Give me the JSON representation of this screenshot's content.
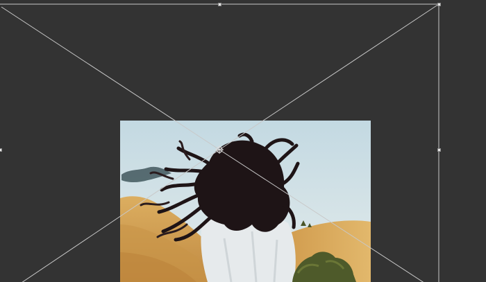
{
  "app": {
    "mode": "free-transform",
    "canvas_color": "#333333",
    "guide_color": "#c8c8c8",
    "handle_color": "#e6e6e6"
  },
  "layer": {
    "content": "photo-woman-hair-flying-desert",
    "palette": {
      "sky_top": "#c6dbe3",
      "sky_bottom": "#dde8ea",
      "sand_light": "#d9a95a",
      "sand_dark": "#b8843a",
      "hair": "#1e1416",
      "sweater": "#e8ecee",
      "shrub": "#4e5a2a"
    }
  }
}
